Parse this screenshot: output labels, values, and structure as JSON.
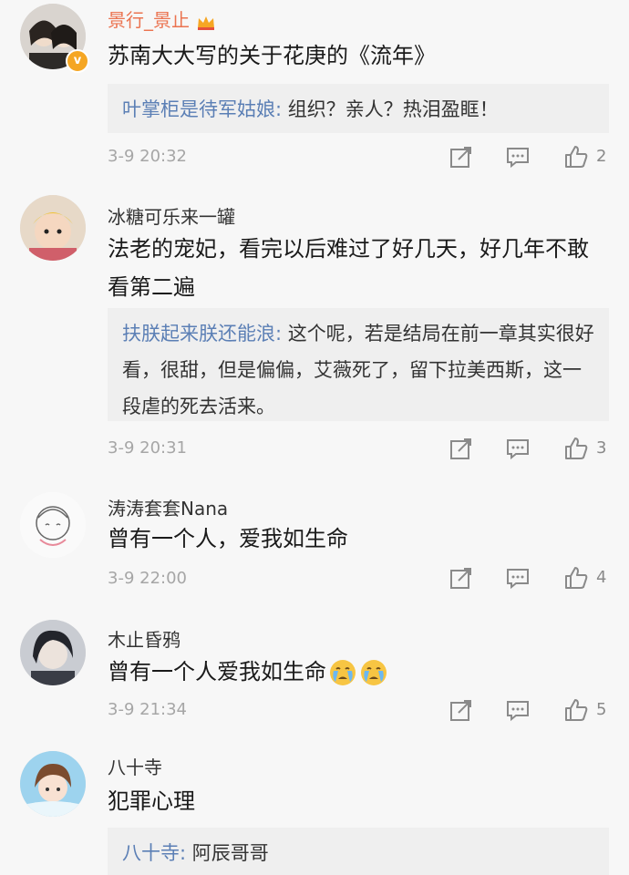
{
  "comments": [
    {
      "username": "景行_景止",
      "has_crown": true,
      "verified": true,
      "text": "苏南大大写的关于花庚的《流年》",
      "reply": {
        "name": "叶掌柜是待军姑娘:",
        "text": " 组织？亲人？热泪盈眶！"
      },
      "time": "3-9 20:32",
      "likes": "2"
    },
    {
      "username": "冰糖可乐来一罐",
      "text": "法老的宠妃，看完以后难过了好几天，好几年不敢看第二遍",
      "reply": {
        "name": "扶朕起来朕还能浪:",
        "text": " 这个呢，若是结局在前一章其实很好看，很甜，但是偏偏，艾薇死了，留下拉美西斯，这一段虐的死去活来。"
      },
      "time": "3-9 20:31",
      "likes": "3"
    },
    {
      "username": "涛涛套套Nana",
      "text": "曾有一个人，爱我如生命",
      "time": "3-9 22:00",
      "likes": "4"
    },
    {
      "username": "木止昏鸦",
      "text": "曾有一个人爱我如生命",
      "emoji": [
        "crying-face-icon",
        "crying-face-icon"
      ],
      "time": "3-9 21:34",
      "likes": "5"
    },
    {
      "username": "八十寺",
      "text": "犯罪心理",
      "reply": {
        "name": "八十寺:",
        "text": " 阿辰哥哥"
      }
    }
  ],
  "icons": {
    "share": "share-icon",
    "comment": "comment-icon",
    "like": "thumbs-up-icon"
  },
  "colors": {
    "link_blue": "#5b7fb5",
    "username_orange": "#eb7350",
    "meta_gray": "#a6a6a6"
  }
}
